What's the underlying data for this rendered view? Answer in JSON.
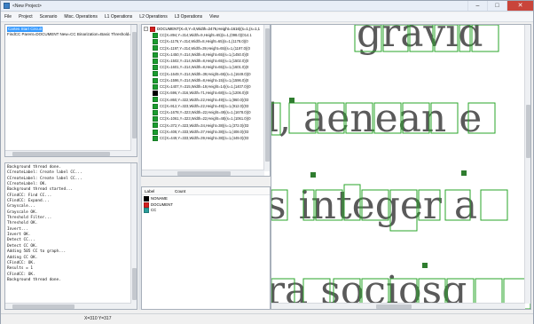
{
  "window": {
    "title": "<New Project>",
    "minimize": "–",
    "maximize": "□",
    "close": "✕"
  },
  "menu": [
    "File",
    "Project",
    "Scenario",
    "Misc. Operations",
    "L1 Operations",
    "L2 Operations",
    "L3 Operations",
    "View"
  ],
  "project_panel": {
    "selected": "Cartes Start Circuit",
    "line": "FindCC Parent=DOCUMENT New=CC Binarization=Basic Threshold="
  },
  "log_lines": [
    "Background thread done.",
    "CCreateLabel: Create label CC...",
    "CCreateLabel: Create label CC...",
    "CCreateLabel: OK.",
    "Background thread started...",
    "CFindCC: Find CC...",
    "CFindCC: Expand...",
    "Grayscale...",
    "Grayscale OK.",
    "Threshold Filter...",
    "Threshold OK.",
    "Invert...",
    "Invert OK.",
    "Detect CC...",
    "Detect CC OK.",
    "Adding 505 CC to graph...",
    "Adding CC OK.",
    "CFindCC: OK.",
    "Results = 1",
    "CFindCC: OK.",
    "Background thread done."
  ],
  "tree": {
    "root": "DOCUMENT(X=0,Y=0,Width=2476,Height=1616)(s=1,(s=1,1",
    "items": [
      "CC(X=894,Y=314,Width=9,Height=65)(s=1,(098.0)(014.1",
      "CC(X=1176,Y=314,Width=8,Height=65)(s=1,(1178.0)(0",
      "CC(X=1197,Y=314,Width=39,Height=65)(s=1,(1197.0)(0",
      "CC(X=1450,Y=314,Width=8,Height=65)(s=1,(1450.0)(0",
      "CC(X=1502,Y=314,Width=8,Height=65)(s=1,(1502.0)(0",
      "CC(X=1601,Y=314,Width=8,Height=65)(s=1,(1601.0)(0",
      "CC(X=1649,Y=314,Width=39,Height=65)(s=1,(1649.0)(0",
      "CC(X=1596,Y=314,Width=8,Height=15)(s=1,(1596.0)(0",
      "CC(X=1407,Y=315,Width=19,Height=14)(s=1,(1407.0)(0",
      "CC(X=596,Y=316,Width=71,Height=68)(s=1,(1206.0)(0",
      "CC(X=860,Y=322,Width=22,Height=49)(s=1,(860.0)(03",
      "CC(X=912,Y=323,Width=22,Height=49)(s=1,(912.0)(03",
      "CC(X=1678,Y=323,Width=22,Height=49)(s=1,(1678.0)(0",
      "CC(X=1061,Y=323,Width=22,Height=48)(s=1,(1061.0)(0",
      "CC(X=372,Y=323,Width=34,Height=38)(s=1,(372.0)(03",
      "CC(X=408,Y=333,Width=37,Height=38)(s=1,(408.0)(03",
      "CC(X=449,Y=333,Width=39,Height=38)(s=1,(449.0)(03"
    ],
    "item_colors": [
      "#1a9c2e",
      "#1a9c2e",
      "#1a9c2e",
      "#1a9c2e",
      "#1a9c2e",
      "#1a9c2e",
      "#1a9c2e",
      "#1a9c2e",
      "#1a9c2e",
      "#000000",
      "#1a9c2e",
      "#1a9c2e",
      "#1a9c2e",
      "#1a9c2e",
      "#1a9c2e",
      "#1a9c2e",
      "#1a9c2e"
    ]
  },
  "labels_table": {
    "headers": [
      "Label",
      "Count"
    ],
    "rows": [
      {
        "label": "NONAME",
        "color": "#000000"
      },
      {
        "label": "DOCUMENT",
        "color": "#d42020"
      },
      {
        "label": "CC",
        "color": "#2a9d9a"
      }
    ]
  },
  "status": {
    "text": "X=310 Y=317"
  },
  "canvas_text": {
    "line1": "gravid",
    "line2": "l, aenean e",
    "line3": "s integer a",
    "line4": "ra sociosq"
  },
  "colors": {
    "box": "#2aa52a",
    "accent": "#3399ff"
  },
  "icons": [
    "app-icon",
    "minimize-icon",
    "maximize-icon",
    "close-icon",
    "expand-icon",
    "color-swatch-icon"
  ]
}
